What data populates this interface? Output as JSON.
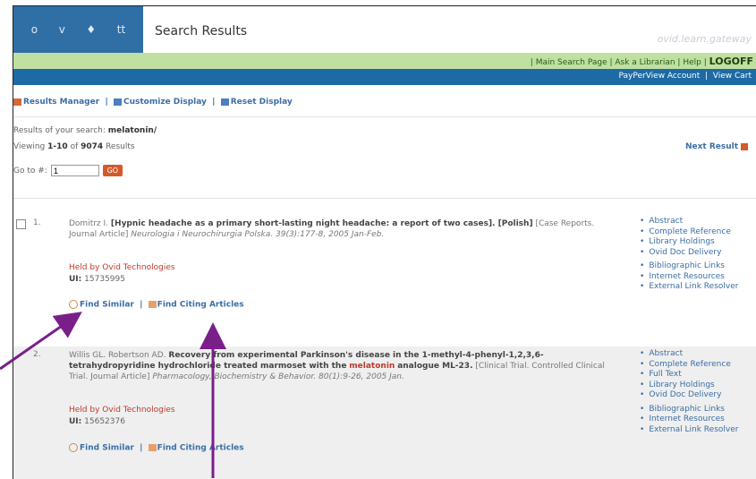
{
  "header": {
    "nav_icons": [
      "o",
      "v",
      "♦",
      "tt"
    ],
    "title": "Search Results",
    "ovid_text": "ovid.learn.gateway"
  },
  "greenbar": {
    "main_search": "Main Search Page",
    "ask_librarian": "Ask a Librarian",
    "help": "Help",
    "logoff": "LOGOFF"
  },
  "bluebar": {
    "payperview": "PayPerView Account",
    "view_cart": "View Cart"
  },
  "toolbar": {
    "results_manager": "Results Manager",
    "customize": "Customize Display",
    "reset": "Reset Display"
  },
  "search": {
    "prefix": "Results of your search:",
    "term": "melatonin/"
  },
  "viewing": {
    "prefix": "Viewing",
    "range": "1-10",
    "of": "of",
    "total": "9074",
    "suffix": "Results"
  },
  "next_result": "Next Result",
  "goto": {
    "label": "Go to #:",
    "value": "1",
    "button": "GO"
  },
  "results": [
    {
      "num": "1.",
      "authors": "Domitrz I.",
      "title": "[Hypnic headache as a primary short-lasting night headache: a report of two cases]. [Polish]",
      "meta": "[Case Reports. Journal Article]",
      "source": "Neurologia i Neurochirurgia Polska. 39(3):177-8, 2005 Jan-Feb.",
      "held": "Held by Ovid Technologies",
      "ui_label": "UI:",
      "ui_value": "15735995",
      "find_similar": "Find Similar",
      "find_citing": "Find Citing Articles",
      "links": [
        "Abstract",
        "Complete Reference",
        "Library Holdings",
        "Ovid Doc Delivery",
        "Bibliographic Links",
        "Internet Resources",
        "External Link Resolver"
      ]
    },
    {
      "num": "2.",
      "authors": "Willis GL. Robertson AD.",
      "title_a": "Recovery from experimental Parkinson's disease in the 1-methyl-4-phenyl-1,2,3,6-tetrahydropyridine hydrochloride treated marmoset with the",
      "keyword": "melatonin",
      "title_b": "analogue ML-23.",
      "meta": "[Clinical Trial. Controlled Clinical Trial. Journal Article]",
      "source": "Pharmacology, Biochemistry & Behavior. 80(1):9-26, 2005 Jan.",
      "held": "Held by Ovid Technologies",
      "ui_label": "UI:",
      "ui_value": "15652376",
      "find_similar": "Find Similar",
      "find_citing": "Find Citing Articles",
      "links": [
        "Abstract",
        "Complete Reference",
        "Full Text",
        "Library Holdings",
        "Ovid Doc Delivery",
        "Bibliographic Links",
        "Internet Resources",
        "External Link Resolver"
      ]
    }
  ],
  "colors": {
    "nav_blue": "#2f6fa6",
    "green_bar": "#bfe0a0",
    "blue_bar": "#1e6aa4",
    "link_blue": "#3a6ea5",
    "keyword_red": "#c0392b",
    "arrow_purple": "#7a1f8a"
  }
}
